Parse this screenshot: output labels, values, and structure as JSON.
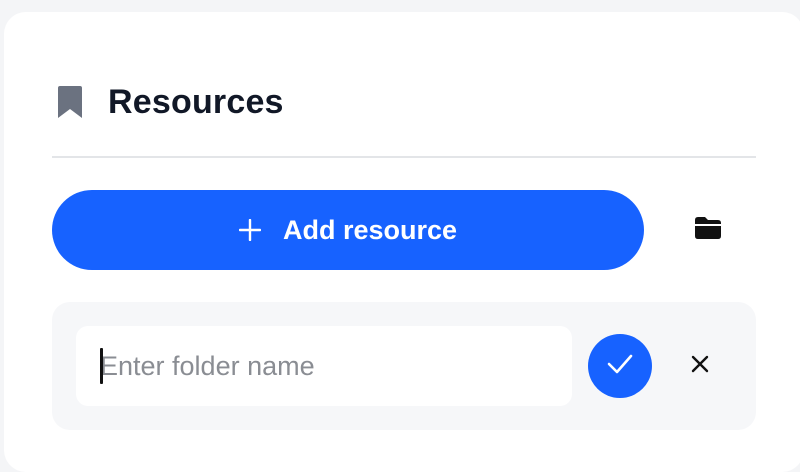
{
  "header": {
    "icon": "bookmark-icon",
    "title": "Resources"
  },
  "toolbar": {
    "add_button": {
      "icon": "plus-icon",
      "label": "Add resource"
    },
    "folder_button": {
      "icon": "folder-icon"
    }
  },
  "new_folder": {
    "input_value": "",
    "input_placeholder": "Enter folder name",
    "confirm_icon": "check-icon",
    "cancel_icon": "close-icon"
  },
  "colors": {
    "accent": "#1762ff",
    "title_text": "#111827",
    "icon_muted": "#6b7280",
    "placeholder": "#8a8d93",
    "row_background": "#f6f7f9"
  }
}
